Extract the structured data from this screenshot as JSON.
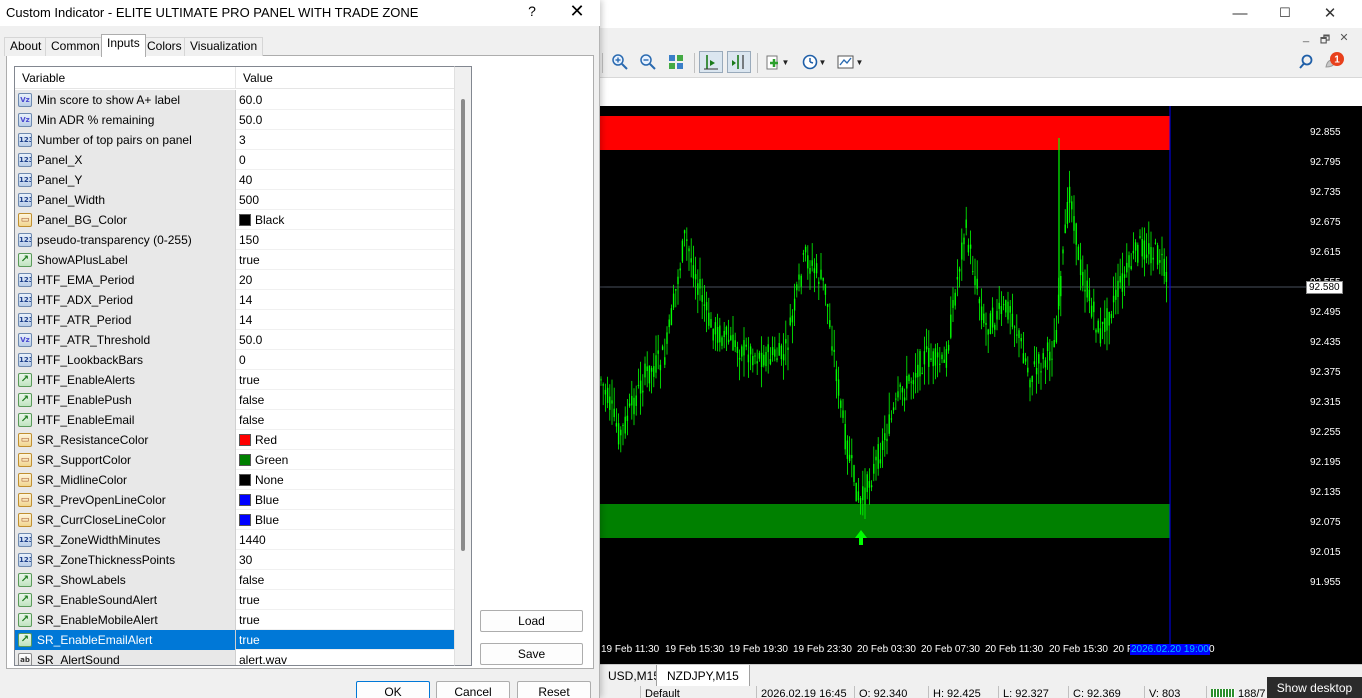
{
  "dialog": {
    "title": "Custom Indicator - ELITE ULTIMATE PRO PANEL WITH TRADE ZONE",
    "help_glyph": "?",
    "close_glyph": "✕",
    "tabs": [
      {
        "label": "About",
        "active": false
      },
      {
        "label": "Common",
        "active": false
      },
      {
        "label": "Inputs",
        "active": true
      },
      {
        "label": "Colors",
        "active": false
      },
      {
        "label": "Visualization",
        "active": false
      }
    ],
    "grid": {
      "col_variable": "Variable",
      "col_value": "Value",
      "rows": [
        {
          "type": "double",
          "icon": "Vz",
          "name": "Min score to show A+ label",
          "value": "60.0"
        },
        {
          "type": "double",
          "icon": "Vz",
          "name": "Min ADR % remaining",
          "value": "50.0"
        },
        {
          "type": "int",
          "icon": "123",
          "name": "Number of top pairs on panel",
          "value": "3"
        },
        {
          "type": "int",
          "icon": "123",
          "name": "Panel_X",
          "value": "0"
        },
        {
          "type": "int",
          "icon": "123",
          "name": "Panel_Y",
          "value": "40"
        },
        {
          "type": "int",
          "icon": "123",
          "name": "Panel_Width",
          "value": "500"
        },
        {
          "type": "color",
          "icon": "▭",
          "name": "Panel_BG_Color",
          "value": "Black",
          "swatch": "#000000"
        },
        {
          "type": "int",
          "icon": "123",
          "name": "pseudo-transparency (0-255)",
          "value": "150"
        },
        {
          "type": "bool",
          "icon": "↗",
          "name": "ShowAPlusLabel",
          "value": "true"
        },
        {
          "type": "int",
          "icon": "123",
          "name": "HTF_EMA_Period",
          "value": "20"
        },
        {
          "type": "int",
          "icon": "123",
          "name": "HTF_ADX_Period",
          "value": "14"
        },
        {
          "type": "int",
          "icon": "123",
          "name": "HTF_ATR_Period",
          "value": "14"
        },
        {
          "type": "double",
          "icon": "Vz",
          "name": "HTF_ATR_Threshold",
          "value": "50.0"
        },
        {
          "type": "int",
          "icon": "123",
          "name": "HTF_LookbackBars",
          "value": "0"
        },
        {
          "type": "bool",
          "icon": "↗",
          "name": "HTF_EnableAlerts",
          "value": "true"
        },
        {
          "type": "bool",
          "icon": "↗",
          "name": "HTF_EnablePush",
          "value": "false"
        },
        {
          "type": "bool",
          "icon": "↗",
          "name": "HTF_EnableEmail",
          "value": "false"
        },
        {
          "type": "color",
          "icon": "▭",
          "name": "SR_ResistanceColor",
          "value": "Red",
          "swatch": "#ff0000"
        },
        {
          "type": "color",
          "icon": "▭",
          "name": "SR_SupportColor",
          "value": "Green",
          "swatch": "#008000"
        },
        {
          "type": "color",
          "icon": "▭",
          "name": "SR_MidlineColor",
          "value": "None",
          "swatch": "#000000"
        },
        {
          "type": "color",
          "icon": "▭",
          "name": "SR_PrevOpenLineColor",
          "value": "Blue",
          "swatch": "#0000ff"
        },
        {
          "type": "color",
          "icon": "▭",
          "name": "SR_CurrCloseLineColor",
          "value": "Blue",
          "swatch": "#0000ff"
        },
        {
          "type": "int",
          "icon": "123",
          "name": "SR_ZoneWidthMinutes",
          "value": "1440"
        },
        {
          "type": "int",
          "icon": "123",
          "name": "SR_ZoneThicknessPoints",
          "value": "30"
        },
        {
          "type": "bool",
          "icon": "↗",
          "name": "SR_ShowLabels",
          "value": "false"
        },
        {
          "type": "bool",
          "icon": "↗",
          "name": "SR_EnableSoundAlert",
          "value": "true"
        },
        {
          "type": "bool",
          "icon": "↗",
          "name": "SR_EnableMobileAlert",
          "value": "true"
        },
        {
          "type": "bool",
          "icon": "↗",
          "name": "SR_EnableEmailAlert",
          "value": "true",
          "selected": true
        },
        {
          "type": "string",
          "icon": "ab",
          "name": "SR_AlertSound",
          "value": "alert.wav"
        }
      ]
    },
    "load_label": "Load",
    "save_label": "Save",
    "ok_label": "OK",
    "cancel_label": "Cancel",
    "reset_label": "Reset"
  },
  "terminal": {
    "minimize_glyph": "—",
    "maximize_glyph": "☐",
    "close_glyph": "✕",
    "mdi_minimize": "_",
    "mdi_restore": "🗗",
    "mdi_close": "✕",
    "notification_count": "1",
    "chart": {
      "price_labels": [
        "92.855",
        "92.795",
        "92.735",
        "92.675",
        "92.615",
        "92.555",
        "92.495",
        "92.435",
        "92.375",
        "92.315",
        "92.255",
        "92.195",
        "92.135",
        "92.075",
        "92.015",
        "91.955"
      ],
      "current_price": "92.580",
      "time_labels": [
        "19 Feb 11:30",
        "19 Feb 15:30",
        "19 Feb 19:30",
        "19 Feb 23:30",
        "20 Feb 03:30",
        "20 Feb 07:30",
        "20 Feb 11:30",
        "20 Feb 15:30",
        "20 Feb"
      ],
      "time_highlight": "2026.02.20 19:00",
      "time_tail": "0",
      "colors": {
        "resistance": "#ff0000",
        "support": "#008000",
        "candles": "#00ff00",
        "vline": "#0000ff",
        "background": "#000000"
      }
    },
    "chart_tabs": [
      {
        "label": "USD,M15",
        "active": false
      },
      {
        "label": "NZDJPY,M15",
        "active": true
      }
    ],
    "status": {
      "profile": "Default",
      "datetime": "2026.02.19 16:45",
      "open": "O: 92.340",
      "high": "H: 92.425",
      "low": "L: 92.327",
      "close": "C: 92.369",
      "volume": "V: 803",
      "connection": "188/7"
    },
    "show_desktop": "Show desktop"
  }
}
